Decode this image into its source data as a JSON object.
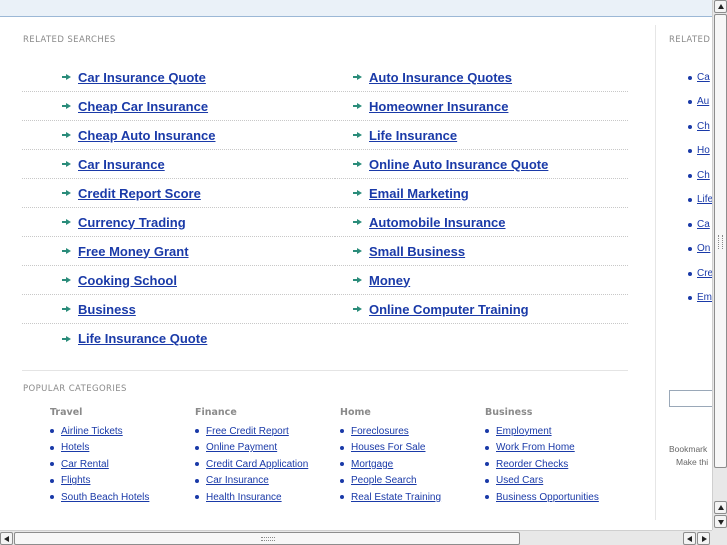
{
  "related_searches": {
    "title": "RELATED SEARCHES",
    "left": [
      "Car Insurance Quote",
      "Cheap Car Insurance",
      "Cheap Auto Insurance",
      "Car Insurance",
      "Credit Report Score",
      "Currency Trading",
      "Free Money Grant",
      "Cooking School",
      "Business",
      "Life Insurance Quote"
    ],
    "right": [
      "Auto Insurance Quotes",
      "Homeowner Insurance",
      "Life Insurance",
      "Online Auto Insurance Quote",
      "Email Marketing",
      "Automobile Insurance",
      "Small Business",
      "Money",
      "Online Computer Training"
    ]
  },
  "popular_categories": {
    "title": "POPULAR CATEGORIES",
    "columns": [
      {
        "heading": "Travel",
        "items": [
          "Airline Tickets",
          "Hotels",
          "Car Rental",
          "Flights",
          "South Beach Hotels"
        ]
      },
      {
        "heading": "Finance",
        "items": [
          "Free Credit Report",
          "Online Payment",
          "Credit Card Application",
          "Car Insurance",
          "Health Insurance"
        ]
      },
      {
        "heading": "Home",
        "items": [
          "Foreclosures",
          "Houses For Sale",
          "Mortgage",
          "People Search",
          "Real Estate Training"
        ]
      },
      {
        "heading": "Business",
        "items": [
          "Employment",
          "Work From Home",
          "Reorder Checks",
          "Used Cars",
          "Business Opportunities"
        ]
      }
    ]
  },
  "sidebar": {
    "title": "RELATED",
    "items": [
      "Ca",
      "Au",
      "Ch",
      "Ho",
      "Ch",
      "Life",
      "Ca",
      "On",
      "Cre",
      "Em"
    ],
    "bookmark_text": "Bookmark",
    "make_text": "Make thi"
  }
}
